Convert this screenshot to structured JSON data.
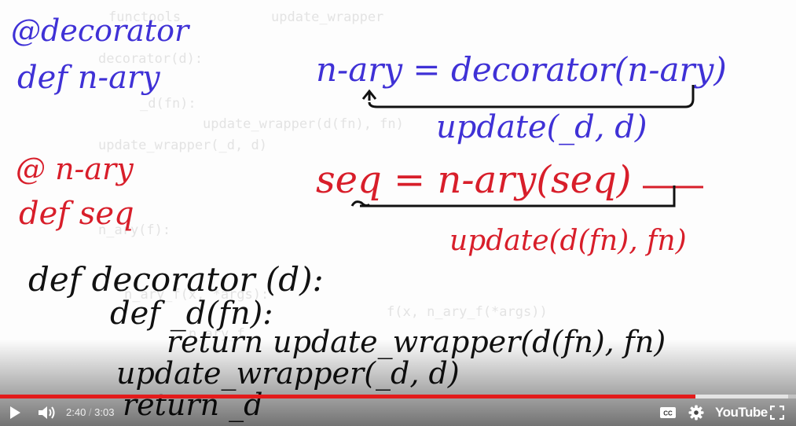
{
  "player": {
    "current_time": "2:40",
    "separator": " / ",
    "duration": "3:03",
    "progress_fraction": 0.874,
    "buffered_fraction": 0.99,
    "logo_text": "YouTube",
    "accent_color": "#e31b1b"
  },
  "board": {
    "ghost_code": [
      "functools",
      "update_wrapper",
      "decorator(d):",
      "_d(fn):",
      "update_wrapper(d(fn), fn)",
      "update_wrapper(_d, d)",
      "n_ary(f):",
      "n_ary_f(x, *args):",
      "f(x, n_ary_f(*args))",
      "n_ary_f"
    ],
    "blue_notes": {
      "decorator_tag": "@decorator",
      "def_nary": "def n-ary",
      "equation": "n-ary = decorator(n-ary)",
      "update": "update(_d, d)"
    },
    "red_notes": {
      "nary_tag": "@ n-ary",
      "def_seq": "def seq",
      "equation": "seq = n-ary(seq)",
      "update": "update(d(fn), fn)"
    },
    "black_notes": {
      "line1": "def decorator (d):",
      "line2": "def _d(fn):",
      "line3": "return update_wrapper(d(fn), fn)",
      "line4": "update_wrapper(_d, d)",
      "line5": "return _d"
    }
  },
  "colors": {
    "blue_ink": "#3f31d6",
    "red_ink": "#d81e2a",
    "black_ink": "#111111",
    "ghost_text": "#e3e3e3"
  },
  "icons": {
    "play": "play-icon",
    "volume": "volume-icon",
    "captions": "captions-icon",
    "settings": "gear-icon",
    "fullscreen": "fullscreen-icon"
  }
}
